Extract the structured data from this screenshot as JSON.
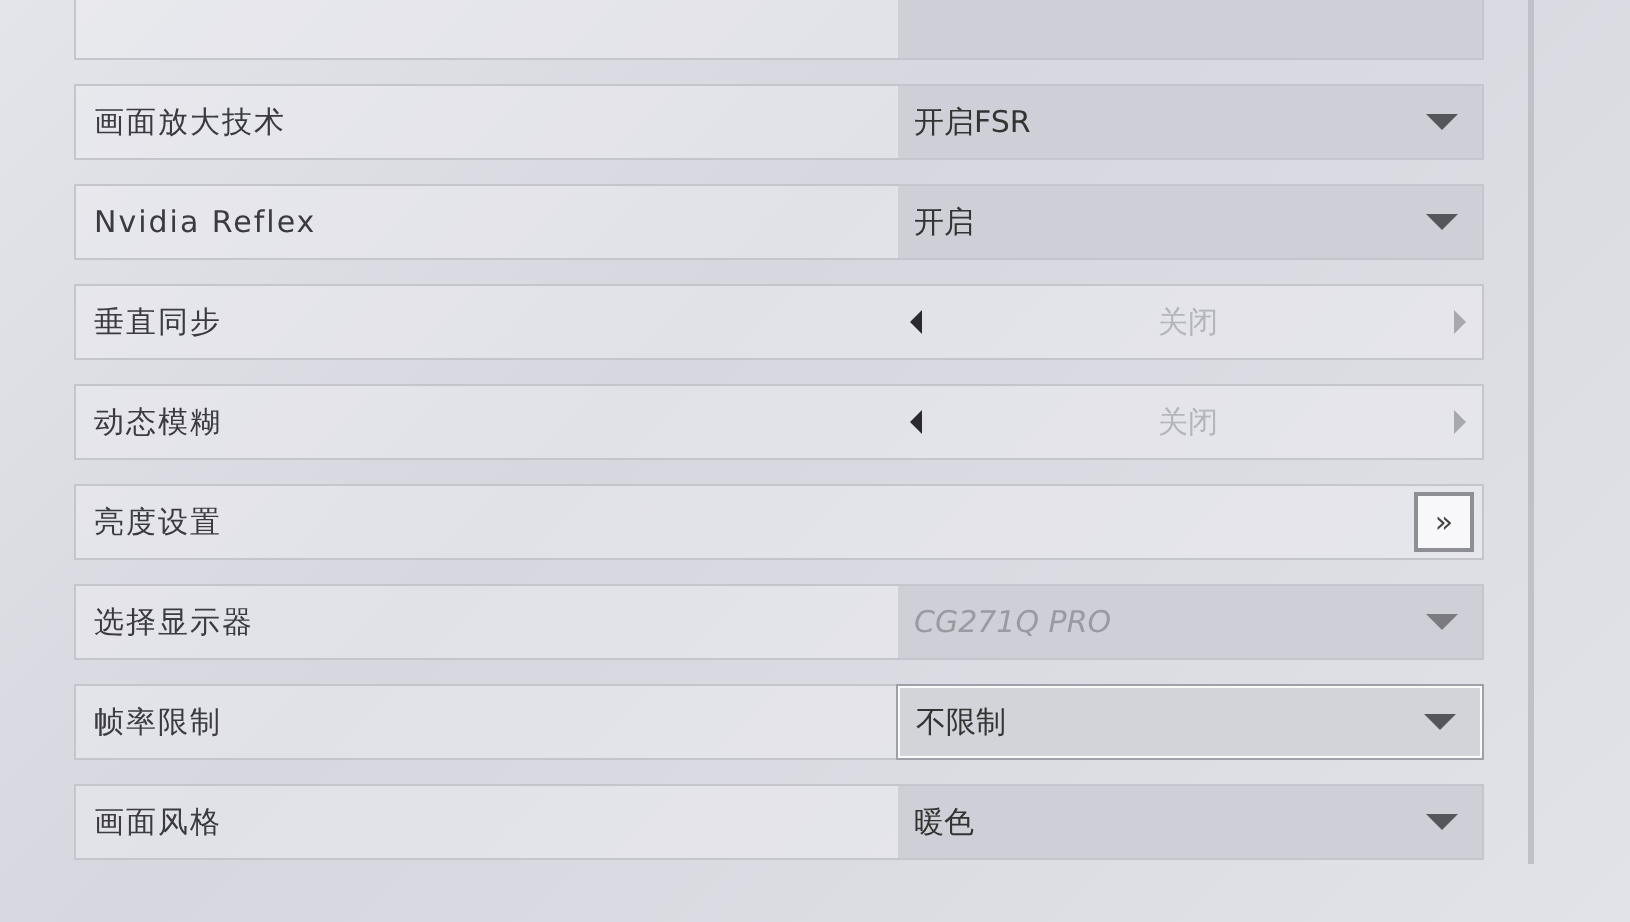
{
  "settings": [
    {
      "kind": "partial"
    },
    {
      "kind": "dropdown",
      "label": "画面放大技术",
      "value": "开启FSR",
      "disabled": false,
      "focused": false
    },
    {
      "kind": "dropdown",
      "label": "Nvidia Reflex",
      "value": "开启",
      "disabled": false,
      "focused": false
    },
    {
      "kind": "stepper",
      "label": "垂直同步",
      "value": "关闭",
      "disabled": true
    },
    {
      "kind": "stepper",
      "label": "动态模糊",
      "value": "关闭",
      "disabled": true
    },
    {
      "kind": "button",
      "label": "亮度设置",
      "button": "»"
    },
    {
      "kind": "dropdown",
      "label": "选择显示器",
      "value": "CG271Q PRO",
      "disabled": true,
      "focused": false
    },
    {
      "kind": "dropdown",
      "label": "帧率限制",
      "value": "不限制",
      "disabled": false,
      "focused": true
    },
    {
      "kind": "dropdown",
      "label": "画面风格",
      "value": "暖色",
      "disabled": false,
      "focused": false
    }
  ]
}
